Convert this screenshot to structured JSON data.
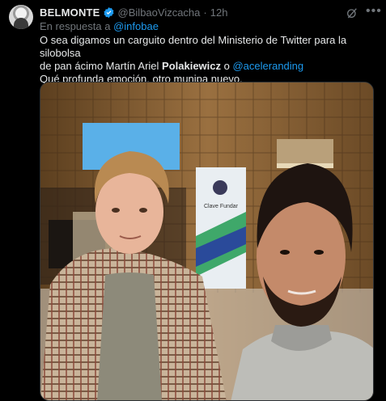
{
  "tweet": {
    "author_name": "BELMONTE",
    "author_handle": "@BilbaoVizcacha",
    "separator": "·",
    "time": "12h",
    "reply_prefix": "En respuesta a",
    "reply_to": "@infobae",
    "line1": "O sea digamos un carguito dentro del Ministerio de Twitter para la silobolsa",
    "line2_start": "de pan ácimo Martín Ariel ",
    "line2_bold": "Polakiewicz",
    "line2_mid": " o ",
    "line2_mention": "@aceleranding",
    "line3": "Qué profunda emoción, otro munipa nuevo."
  },
  "icons": {
    "verified": "verified-badge-icon",
    "grok": "grok-icon",
    "more": "more-options-icon"
  },
  "photo": {
    "banner_text": "Clave Fundar"
  },
  "colors": {
    "background": "#000000",
    "text": "#e7e9ea",
    "secondary": "#71767b",
    "link": "#1d9bf0",
    "wall": "#8a6338"
  }
}
